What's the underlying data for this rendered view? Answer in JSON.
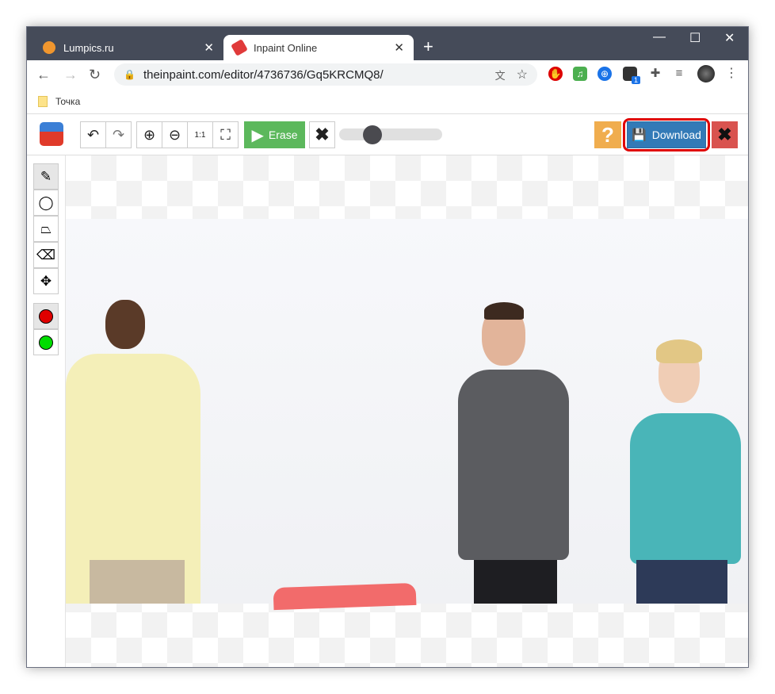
{
  "browser": {
    "tabs": [
      {
        "title": "Lumpics.ru",
        "active": false
      },
      {
        "title": "Inpaint Online",
        "active": true
      }
    ],
    "url": "theinpaint.com/editor/4736736/Gq5KRCMQ8/",
    "bookmarks": [
      {
        "label": "Точка"
      }
    ],
    "extension_badge": "1"
  },
  "toolbar": {
    "erase_label": "Erase",
    "download_label": "Download",
    "help_label": "?",
    "brush_size_fraction": 0.33,
    "highlighted_button": "download"
  },
  "side_tools": [
    "marker",
    "lasso",
    "polygon-lasso",
    "eraser",
    "move"
  ],
  "colors": {
    "accent_green": "#5cb85c",
    "download_blue": "#337ab7",
    "help_orange": "#f0ad4e",
    "close_red": "#d9534f",
    "highlight": "#e00000",
    "marker_red": "#e00000",
    "marker_green": "#00dd00"
  }
}
